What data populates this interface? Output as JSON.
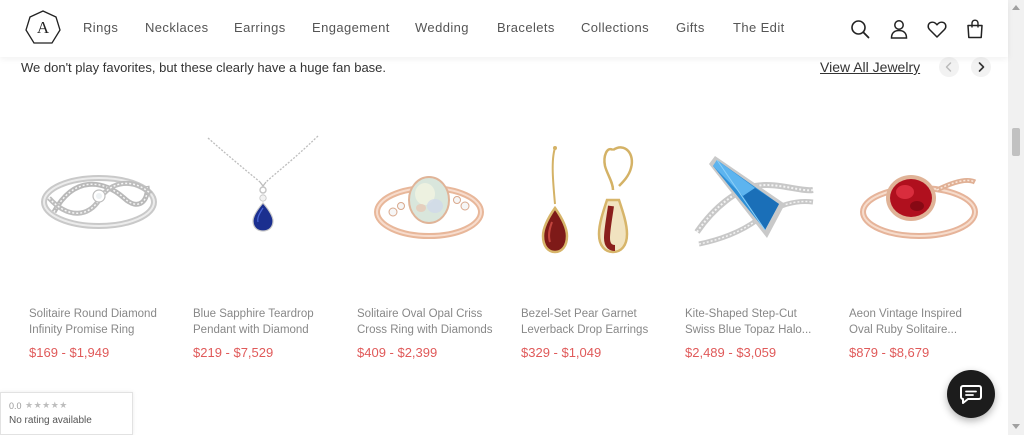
{
  "header": {
    "logo_letter": "A",
    "nav": [
      {
        "label": "Rings"
      },
      {
        "label": "Necklaces"
      },
      {
        "label": "Earrings"
      },
      {
        "label": "Engagement"
      },
      {
        "label": "Wedding"
      },
      {
        "label": "Bracelets"
      },
      {
        "label": "Collections"
      },
      {
        "label": "Gifts"
      },
      {
        "label": "The Edit"
      }
    ],
    "icons": [
      "search-icon",
      "account-icon",
      "wishlist-heart-icon",
      "shopping-bag-icon"
    ]
  },
  "section": {
    "tagline": "We don't play favorites, but these clearly have a huge fan base.",
    "view_all_label": "View All Jewelry"
  },
  "products": [
    {
      "name_line1": "Solitaire Round Diamond",
      "name_line2": "Infinity Promise Ring",
      "price": "$169 - $1,949",
      "image": "white-gold-diamond-infinity-ring"
    },
    {
      "name_line1": "Blue Sapphire Teardrop",
      "name_line2": "Pendant with Diamond",
      "price": "$219 - $7,529",
      "image": "blue-sapphire-teardrop-pendant"
    },
    {
      "name_line1": "Solitaire Oval Opal Criss",
      "name_line2": "Cross Ring with Diamonds",
      "price": "$409 - $2,399",
      "image": "rose-gold-opal-ring"
    },
    {
      "name_line1": "Bezel-Set Pear Garnet",
      "name_line2": "Leverback Drop Earrings",
      "price": "$329 - $1,049",
      "image": "garnet-drop-earrings"
    },
    {
      "name_line1": "Kite-Shaped Step-Cut",
      "name_line2": "Swiss Blue Topaz Halo...",
      "price": "$2,489 - $3,059",
      "image": "swiss-blue-topaz-kite-ring"
    },
    {
      "name_line1": "Aeon Vintage Inspired",
      "name_line2": "Oval Ruby Solitaire...",
      "price": "$879 - $8,679",
      "image": "rose-gold-oval-ruby-ring"
    }
  ],
  "rating_widget": {
    "score": "0.0",
    "stars": "★★★★★",
    "text": "No rating available"
  },
  "colors": {
    "price": "#e05a5a",
    "nav_text": "#555555",
    "chat_button": "#1c1c1c"
  }
}
